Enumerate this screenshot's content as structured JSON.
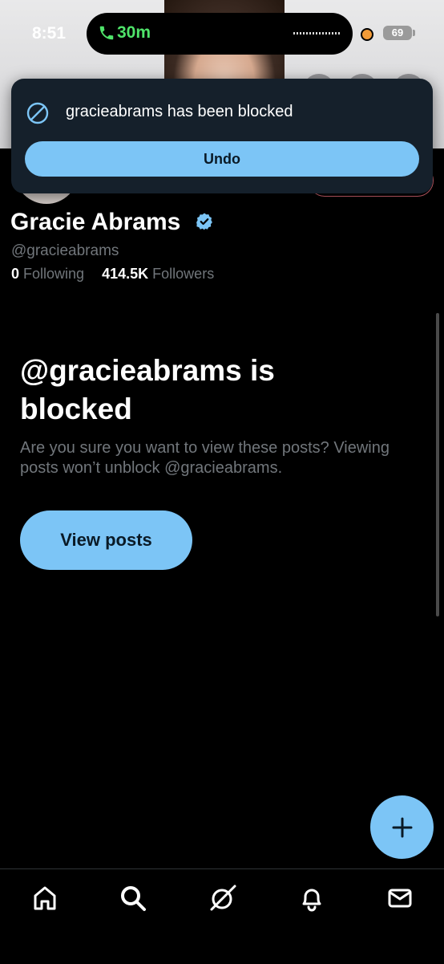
{
  "status_bar": {
    "time": "8:51",
    "call_timer": "30m",
    "battery": "69"
  },
  "toast": {
    "message": "gracieabrams has been blocked",
    "undo_label": "Undo"
  },
  "profile": {
    "name": "Gracie Abrams",
    "handle": "@gracieabrams",
    "following_count": "0",
    "following_label": "Following",
    "followers_count": "414.5K",
    "followers_label": "Followers"
  },
  "blocked_notice": {
    "title": "@gracieabrams is blocked",
    "description": "Are you sure you want to view these posts? Viewing posts won’t unblock @gracieabrams.",
    "view_posts_label": "View posts"
  },
  "fab": {
    "icon": "plus-icon"
  },
  "bottom_nav": {
    "items": [
      {
        "icon": "home-icon"
      },
      {
        "icon": "search-icon"
      },
      {
        "icon": "grok-icon"
      },
      {
        "icon": "bell-icon"
      },
      {
        "icon": "mail-icon"
      }
    ]
  },
  "colors": {
    "accent": "#7cc5f6",
    "background": "#000000",
    "toast_background": "#15202b",
    "muted_text": "#71767b",
    "call_green": "#4fe36a"
  }
}
